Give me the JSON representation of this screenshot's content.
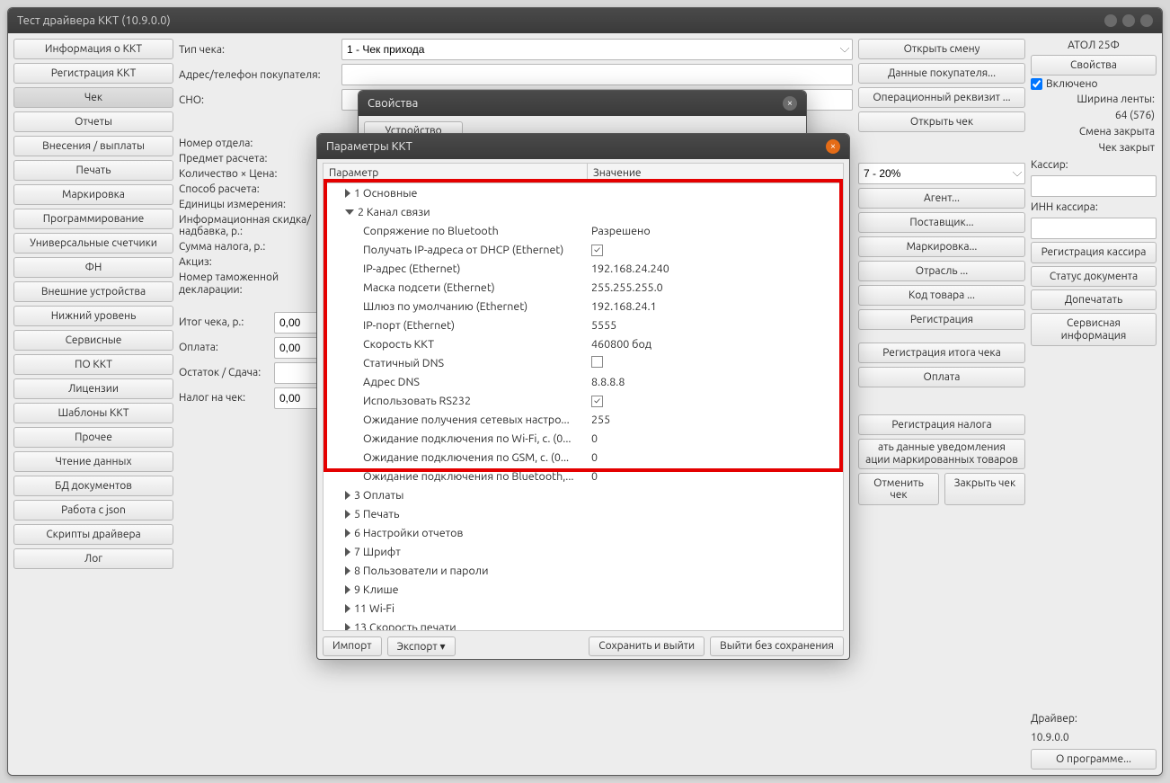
{
  "window": {
    "title": "Тест драйвера ККТ (10.9.0.0)"
  },
  "left_menu": [
    "Информация о ККТ",
    "Регистрация ККТ",
    "Чек",
    "Отчеты",
    "Внесения / выплаты",
    "Печать",
    "Маркировка",
    "Программирование",
    "Универсальные счетчики",
    "ФН",
    "Внешние устройства",
    "Нижний уровень",
    "Сервисные",
    "ПО ККТ",
    "Лицензии",
    "Шаблоны ККТ",
    "Прочее",
    "Чтение данных",
    "БД документов",
    "Работа с json",
    "Скрипты драйвера",
    "Лог"
  ],
  "left_selected_index": 2,
  "form": {
    "receipt_type_label": "Тип чека:",
    "receipt_type_value": "1 - Чек прихода",
    "buyer_label": "Адрес/телефон покупателя:",
    "sno_label": "СНО:",
    "dept_label": "Номер отдела:",
    "subject_label": "Предмет расчета:",
    "qty_price_label": "Количество × Цена:",
    "calc_method_label": "Способ расчета:",
    "units_label": "Единицы измерения:",
    "info_discount_label": "Информационная скидка/надбавка, р.:",
    "tax_sum_label": "Сумма налога, р.:",
    "excise_label": "Акциз:",
    "customs_decl_label": "Номер таможенной декларации:",
    "total_label": "Итог чека, р.:",
    "total_value": "0,00",
    "payment_label": "Оплата:",
    "payment_value": "0,00",
    "change_label": "Остаток / Сдача:",
    "receipt_tax_label": "Налог на чек:",
    "receipt_tax_value": "0,00",
    "tax_select_value": "7 - 20%"
  },
  "actions": {
    "open_shift": "Открыть смену",
    "buyer_data": "Данные покупателя...",
    "oper_requisite": "Операционный реквизит ...",
    "open_receipt": "Открыть чек",
    "agent": "Агент...",
    "supplier": "Поставщик...",
    "marking": "Маркировка...",
    "industry": "Отрасль ...",
    "product_code": "Код товара ...",
    "registration": "Регистрация",
    "reg_total": "Регистрация итога чека",
    "payment": "Оплата",
    "reg_tax": "Регистрация налога",
    "send_mark_notice_l1": "ать данные уведомления",
    "send_mark_notice_l2": "ации маркированных товаров",
    "cancel_receipt": "Отменить чек",
    "close_receipt": "Закрыть чек"
  },
  "right": {
    "model": "АТОЛ 25Ф",
    "properties": "Свойства",
    "enabled_label": "Включено",
    "tape_label": "Ширина ленты:",
    "tape_value": "64 (576)",
    "shift_state": "Смена закрыта",
    "receipt_state": "Чек закрыт",
    "cashier_label": "Кассир:",
    "cashier_inn_label": "ИНН кассира:",
    "register_cashier": "Регистрация кассира",
    "doc_status": "Статус документа",
    "reprint": "Допечатать",
    "service_info_l1": "Сервисная",
    "service_info_l2": "информация",
    "driver_label": "Драйвер:",
    "driver_value": "10.9.0.0",
    "about": "О программе..."
  },
  "props_dialog": {
    "title": "Свойства",
    "device_btn": "Устройство"
  },
  "params_dialog": {
    "title": "Параметры ККТ",
    "col_param": "Параметр",
    "col_value": "Значение",
    "groups_before": [
      {
        "n": "1",
        "name": "Основные"
      }
    ],
    "open_group": {
      "n": "2",
      "name": "Канал связи"
    },
    "rows": [
      {
        "p": "Сопряжение по Bluetooth",
        "v": "Разрешено"
      },
      {
        "p": "Получать IP-адреса от DHCP (Ethernet)",
        "v": "",
        "check": true
      },
      {
        "p": "IP-адрес (Ethernet)",
        "v": "192.168.24.240"
      },
      {
        "p": "Маска подсети (Ethernet)",
        "v": "255.255.255.0"
      },
      {
        "p": "Шлюз по умолчанию (Ethernet)",
        "v": "192.168.24.1"
      },
      {
        "p": "IP-порт (Ethernet)",
        "v": "5555"
      },
      {
        "p": "Скорость ККТ",
        "v": "460800 бод"
      },
      {
        "p": "Статичный DNS",
        "v": "",
        "check": false
      },
      {
        "p": "Адрес DNS",
        "v": "8.8.8.8"
      },
      {
        "p": "Использовать RS232",
        "v": "",
        "check": true
      },
      {
        "p": "Ожидание получения сетевых настро...",
        "v": "255"
      },
      {
        "p": "Ожидание подключения по Wi-Fi, с. (0...",
        "v": "0"
      },
      {
        "p": "Ожидание подключения по GSM, с. (0...",
        "v": "0"
      },
      {
        "p": "Ожидание подключения по Bluetooth,...",
        "v": "0"
      }
    ],
    "groups_after": [
      {
        "n": "3",
        "name": "Оплаты"
      },
      {
        "n": "5",
        "name": "Печать"
      },
      {
        "n": "6",
        "name": "Настройки отчетов"
      },
      {
        "n": "7",
        "name": "Шрифт"
      },
      {
        "n": "8",
        "name": "Пользователи и пароли"
      },
      {
        "n": "9",
        "name": "Клише"
      },
      {
        "n": "11",
        "name": "Wi-Fi"
      },
      {
        "n": "13",
        "name": "Скорость печати"
      }
    ],
    "import": "Импорт",
    "export": "Экспорт",
    "save_exit": "Сохранить и выйти",
    "exit_nosave": "Выйти без сохранения"
  }
}
